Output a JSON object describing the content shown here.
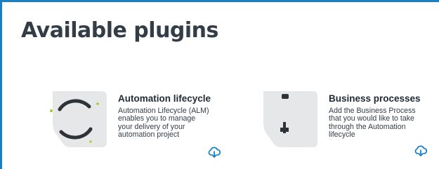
{
  "page": {
    "title": "Available plugins"
  },
  "colors": {
    "accent": "#1b7fc4",
    "plugin_green": "#a8c92a"
  },
  "plugins": [
    {
      "title": "Automation lifecycle",
      "description": "Automation Lifecycle (ALM) enables you to manage your delivery of your automation project",
      "icon": "automation-lifecycle-icon",
      "action_icon": "cloud-download-icon"
    },
    {
      "title": "Business processes",
      "description": "Add the Business Process that you would like to take through the Automation lifecycle",
      "icon": "business-processes-icon",
      "action_icon": "cloud-download-icon"
    }
  ]
}
